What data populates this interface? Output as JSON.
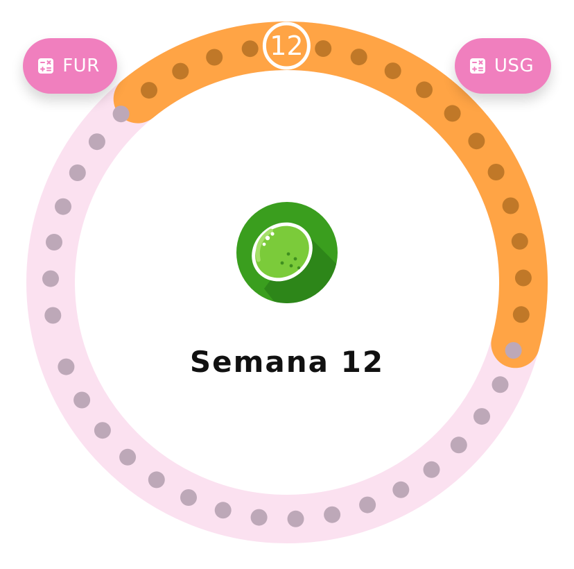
{
  "buttons": {
    "fur": {
      "label": "FUR",
      "icon": "calculator-icon"
    },
    "usg": {
      "label": "USG",
      "icon": "calculator-icon"
    }
  },
  "tracker": {
    "total_weeks": 40,
    "current_week": 12,
    "current_week_label": "12",
    "title": "Semana 12",
    "fruit_icon": "lime-icon"
  },
  "colors": {
    "track": "#fbe1f0",
    "progress": "#ffa445",
    "dot_future": "#bda8b8",
    "dot_done": "#c07828",
    "pill": "#f07fbe",
    "fruit_bg": "#3a9e1e",
    "lime": "#7bcb3a"
  }
}
